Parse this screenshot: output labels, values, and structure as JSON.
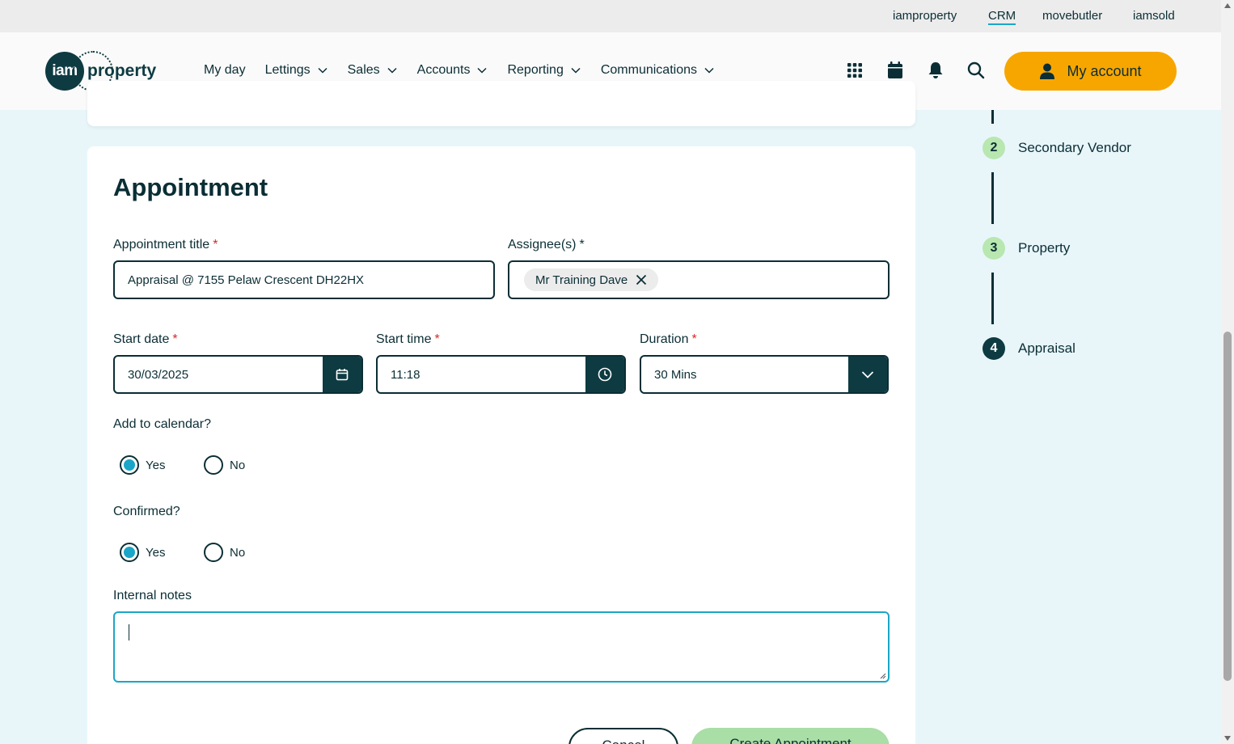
{
  "topbar": {
    "links": [
      "iamproperty",
      "CRM",
      "movebutler",
      "iamsold"
    ],
    "active": "CRM"
  },
  "header": {
    "logo": {
      "circle_text": "iam",
      "word": "property"
    },
    "nav": [
      "My day",
      "Lettings",
      "Sales",
      "Accounts",
      "Reporting",
      "Communications"
    ],
    "icons": [
      "apps-grid-icon",
      "calendar-icon",
      "bell-icon",
      "search-icon"
    ],
    "account_button": "My account"
  },
  "form": {
    "title": "Appointment",
    "appointment_title": {
      "label": "Appointment title",
      "value": "Appraisal @ 7155 Pelaw Crescent  DH22HX"
    },
    "assignees": {
      "label": "Assignee(s)",
      "chips": [
        "Mr Training Dave"
      ]
    },
    "start_date": {
      "label": "Start date",
      "value": "30/03/2025"
    },
    "start_time": {
      "label": "Start time",
      "value": "11:18"
    },
    "duration": {
      "label": "Duration",
      "value": "30 Mins"
    },
    "add_to_calendar": {
      "label": "Add to calendar?",
      "options": [
        "Yes",
        "No"
      ],
      "selected": "Yes"
    },
    "confirmed": {
      "label": "Confirmed?",
      "options": [
        "Yes",
        "No"
      ],
      "selected": "Yes"
    },
    "internal_notes": {
      "label": "Internal notes",
      "value": ""
    },
    "required_marker": "*",
    "buttons": {
      "cancel": "Cancel",
      "create": "Create Appointment"
    }
  },
  "stepper": {
    "steps": [
      {
        "num": "2",
        "label": "Secondary Vendor"
      },
      {
        "num": "3",
        "label": "Property"
      },
      {
        "num": "4",
        "label": "Appraisal",
        "current": true
      }
    ]
  },
  "colors": {
    "page_bg": "#e8f6fa",
    "primary_dark": "#0d3b41",
    "accent_orange": "#f7a600",
    "accent_cyan": "#1aa6c8",
    "step_done_green": "#b8e7b0",
    "create_button_green": "#a9dea6",
    "required_red": "#d62828"
  }
}
